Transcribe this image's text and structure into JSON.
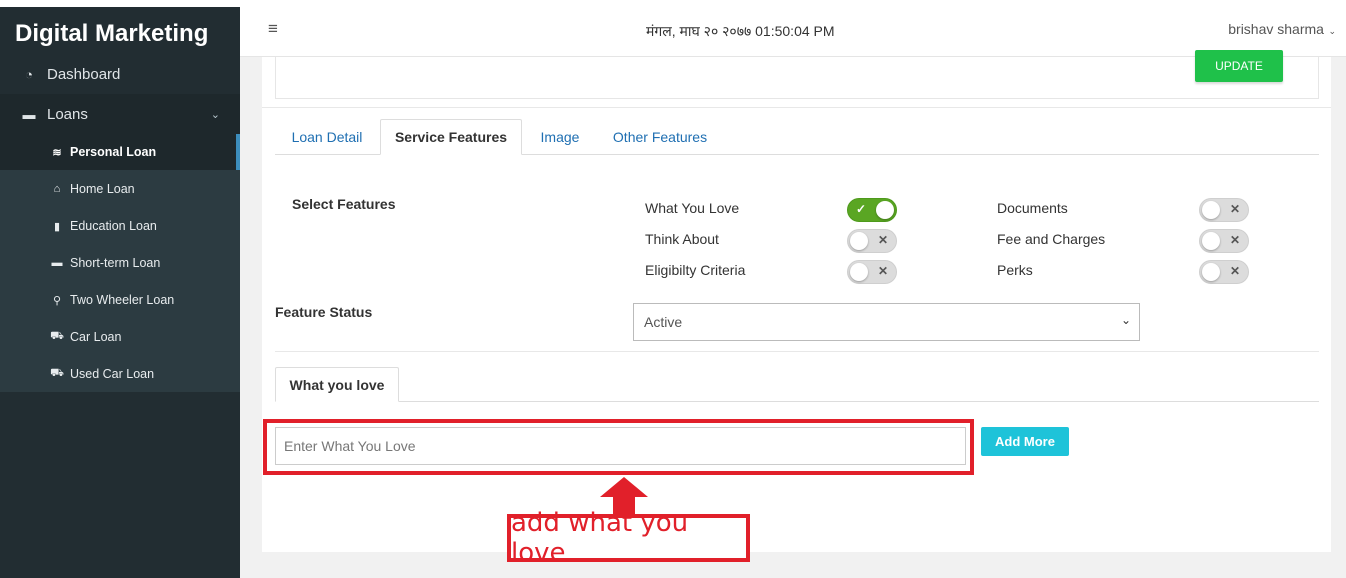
{
  "sidebar": {
    "brand": "Digital Marketing",
    "dashboard": "Dashboard",
    "loans": "Loans",
    "items": [
      {
        "label": "Personal Loan",
        "icon": "money-icon"
      },
      {
        "label": "Home Loan",
        "icon": "home-icon"
      },
      {
        "label": "Education Loan",
        "icon": "book-icon"
      },
      {
        "label": "Short-term Loan",
        "icon": "card-icon"
      },
      {
        "label": "Two Wheeler Loan",
        "icon": "motorcycle-icon"
      },
      {
        "label": "Car Loan",
        "icon": "car-icon"
      },
      {
        "label": "Used Car Loan",
        "icon": "car-icon"
      }
    ]
  },
  "header": {
    "datetime": "मंगल, माघ २० २०७७ 01:50:04 PM",
    "user": "brishav sharma"
  },
  "top": {
    "update_label": "UPDATE"
  },
  "tabs": [
    "Loan Detail",
    "Service Features",
    "Image",
    "Other Features"
  ],
  "features": {
    "title": "Select Features",
    "left": [
      {
        "label": "What You Love",
        "on": true
      },
      {
        "label": "Think About",
        "on": false
      },
      {
        "label": "Eligibilty Criteria",
        "on": false
      }
    ],
    "right": [
      {
        "label": "Documents",
        "on": false
      },
      {
        "label": "Fee and Charges",
        "on": false
      },
      {
        "label": "Perks",
        "on": false
      }
    ]
  },
  "status": {
    "label": "Feature Status",
    "value": "Active"
  },
  "subtab": "What you love",
  "input": {
    "placeholder": "Enter What You Love",
    "add_label": "Add More"
  },
  "annotation": "add what you love",
  "colors": {
    "accent_red": "#e1202a",
    "toggle_on": "#5aa623",
    "update_green": "#1fc14a",
    "add_cyan": "#1ec3d9"
  }
}
